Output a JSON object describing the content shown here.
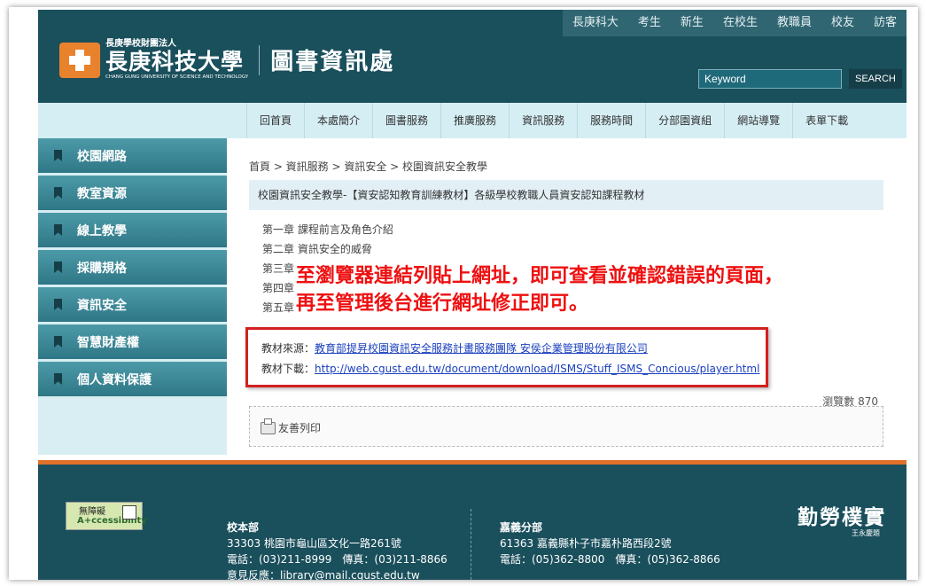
{
  "topnav": [
    "長庚科大",
    "考生",
    "新生",
    "在校生",
    "教職員",
    "校友",
    "訪客"
  ],
  "logo": {
    "org": "長庚學校財團法人",
    "name": "長庚科技大學",
    "english": "CHANG GUNG UNIVERSITY OF SCIENCE AND TECHNOLOGY",
    "dept": "圖書資訊處"
  },
  "search": {
    "placeholder": "Keyword",
    "button": "SEARCH"
  },
  "mainnav": [
    "回首頁",
    "本處簡介",
    "圖書服務",
    "推廣服務",
    "資訊服務",
    "服務時間",
    "分部園資組",
    "網站導覽",
    "表單下載"
  ],
  "sidebar": [
    "校園網路",
    "教室資源",
    "線上教學",
    "採購規格",
    "資訊安全",
    "智慧財產權",
    "個人資料保護"
  ],
  "breadcrumb": "首頁 > 資訊服務 > 資訊安全 > 校園資訊安全教學",
  "page_title": "校園資訊安全教學-【資安認知教育訓練教材】各級學校教職人員資安認知課程教材",
  "chapters": [
    "第一章 課程前言及角色介紹",
    "第二章 資訊安全的威脅",
    "第三章",
    "第四章",
    "第五章"
  ],
  "annotation": [
    "至瀏覽器連結列貼上網址，即可查看並確認錯誤的頁面，",
    "再至管理後台進行網址修正即可。"
  ],
  "source": {
    "label": "教材來源：",
    "value": "教育部提昇校園資訊安全服務計畫服務團隊 安侯企業管理股份有限公司",
    "download_label": "教材下載：",
    "download_url": "http://web.cgust.edu.tw/document/download/ISMS/Stuff_ISMS_Concious/player.html"
  },
  "views": "瀏覽數 870",
  "print": "友善列印",
  "footer": {
    "access_line1": "無障礙",
    "access_line2": "A+ccessibility",
    "campus1_title": "校本部",
    "campus1_addr": "33303 桃園市龜山區文化一路261號",
    "campus1_phone": "電話：(03)211-8999　傳真：(03)211-8866",
    "campus1_email": "意見反應：library@mail.cgust.edu.tw",
    "campus2_title": "嘉義分部",
    "campus2_addr": "61363 嘉義縣朴子市嘉朴路西段2號",
    "campus2_phone": "電話：(05)362-8800　傳真：(05)362-8866",
    "motto": "勤勞樸實",
    "motto_sig": "王永慶題"
  }
}
